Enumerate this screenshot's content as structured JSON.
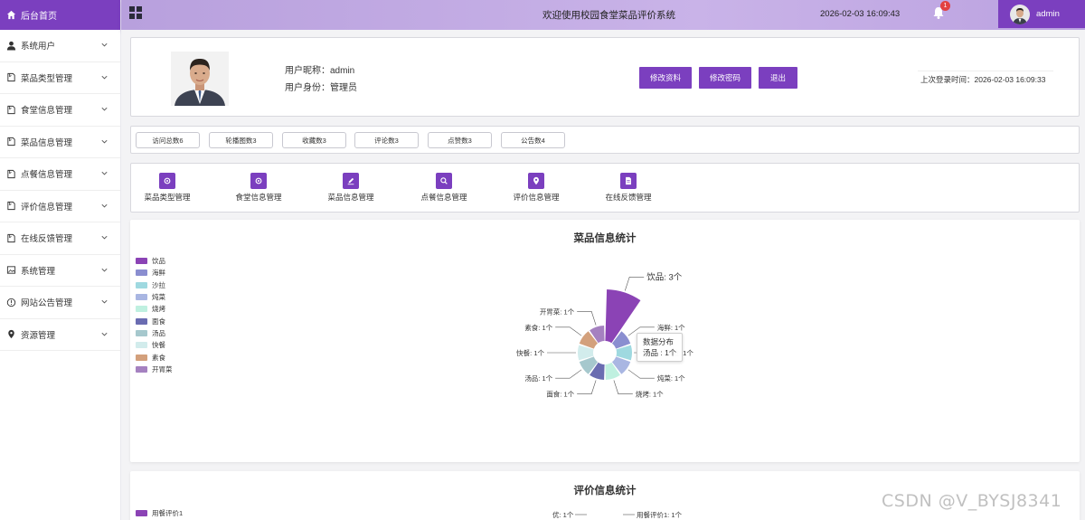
{
  "sidebar": {
    "home": "后台首页",
    "items": [
      {
        "label": "系统用户",
        "icon": "user-icon"
      },
      {
        "label": "菜品类型管理",
        "icon": "document-icon"
      },
      {
        "label": "食堂信息管理",
        "icon": "document-icon"
      },
      {
        "label": "菜品信息管理",
        "icon": "document-icon"
      },
      {
        "label": "点餐信息管理",
        "icon": "document-icon"
      },
      {
        "label": "评价信息管理",
        "icon": "document-icon"
      },
      {
        "label": "在线反馈管理",
        "icon": "document-icon"
      },
      {
        "label": "系统管理",
        "icon": "image-icon"
      },
      {
        "label": "网站公告管理",
        "icon": "info-circle-icon"
      },
      {
        "label": "资源管理",
        "icon": "location-icon"
      }
    ]
  },
  "header": {
    "title": "欢迎使用校园食堂菜品评价系统",
    "datetime": "2026-02-03 16:09:43",
    "notification_count": "1",
    "username": "admin"
  },
  "profile": {
    "nickname": "用户昵称：admin",
    "role": "用户身份：管理员",
    "buttons": {
      "edit": "修改资料",
      "password": "修改密码",
      "logout": "退出"
    },
    "last_login": "上次登录时间：2026-02-03 16:09:33"
  },
  "stats": [
    "访问总数6",
    "轮播图数3",
    "收藏数3",
    "评论数3",
    "点赞数3",
    "公告数4"
  ],
  "quick_links": [
    {
      "label": "菜品类型管理",
      "icon": "gear-icon"
    },
    {
      "label": "食堂信息管理",
      "icon": "gear-icon"
    },
    {
      "label": "菜品信息管理",
      "icon": "edit-icon"
    },
    {
      "label": "点餐信息管理",
      "icon": "search-icon"
    },
    {
      "label": "评价信息管理",
      "icon": "location-icon"
    },
    {
      "label": "在线反馈管理",
      "icon": "file-icon"
    }
  ],
  "chart_data": [
    {
      "type": "pie",
      "subtype": "rose",
      "title": "菜品信息统计",
      "categories": [
        "饮品",
        "海鲜",
        "沙拉",
        "炖菜",
        "烧烤",
        "面食",
        "汤品",
        "快餐",
        "素食",
        "开胃菜"
      ],
      "values": [
        3,
        1,
        1,
        1,
        1,
        1,
        1,
        1,
        1,
        1
      ],
      "labels": [
        "饮品: 3个",
        "海鲜: 1个",
        "沙拉: 1个",
        "炖菜: 1个",
        "烧烤: 1个",
        "面食: 1个",
        "汤品: 1个",
        "快餐: 1个",
        "素食: 1个",
        "开胃菜: 1个"
      ],
      "colors": [
        "#8b43b5",
        "#8a8ed0",
        "#9fd9e0",
        "#a9b6e2",
        "#bff0e0",
        "#6a6cb1",
        "#a6c8cd",
        "#d2ecec",
        "#d3a07c",
        "#a581c0"
      ],
      "legend_position": "left",
      "tooltip": {
        "title": "数据分布",
        "text": "汤品 : 1个"
      }
    },
    {
      "type": "pie",
      "title": "评价信息统计",
      "legend": [
        "用餐评价1"
      ],
      "labels": [
        "优: 1个",
        "用餐评价1: 1个"
      ],
      "colors": [
        "#8b43b5"
      ]
    }
  ],
  "watermark": "CSDN @V_BYSJ8341"
}
